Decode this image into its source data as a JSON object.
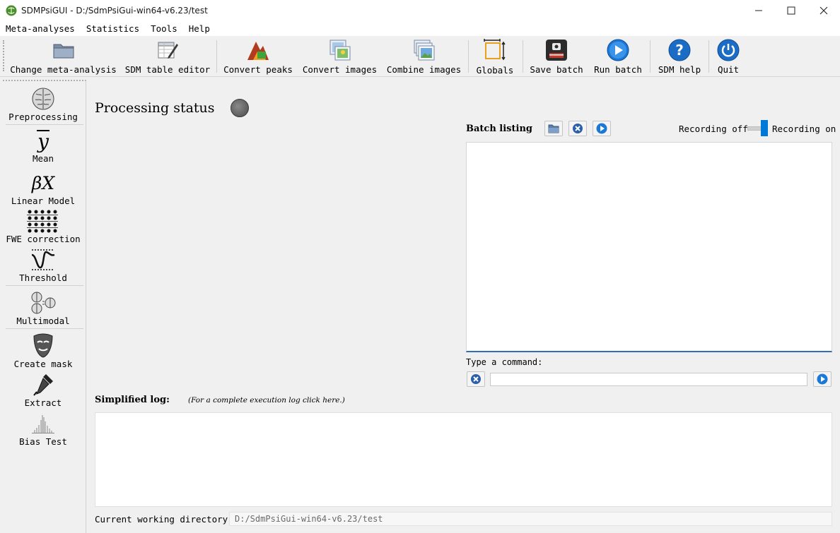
{
  "window": {
    "title": "SDMPsiGUI - D:/SdmPsiGui-win64-v6.23/test",
    "controls": [
      "minimize-icon",
      "maximize-icon",
      "close-icon"
    ]
  },
  "menu": {
    "items": [
      "Meta-analyses",
      "Statistics",
      "Tools",
      "Help"
    ]
  },
  "toolbar": {
    "buttons": [
      {
        "label": "Change meta-analysis",
        "icon": "folder-icon"
      },
      {
        "label": "SDM table editor",
        "icon": "table-edit-icon"
      },
      {
        "label": "Convert peaks",
        "icon": "peaks-icon"
      },
      {
        "label": "Convert images",
        "icon": "image-convert-icon"
      },
      {
        "label": "Combine images",
        "icon": "image-stack-icon"
      },
      {
        "label": "Globals",
        "icon": "globals-icon"
      },
      {
        "label": "Save batch",
        "icon": "save-batch-icon"
      },
      {
        "label": "Run batch",
        "icon": "play-icon"
      },
      {
        "label": "SDM help",
        "icon": "help-icon"
      },
      {
        "label": "Quit",
        "icon": "power-icon"
      }
    ]
  },
  "sidebar": {
    "items": [
      {
        "label": "Preprocessing",
        "icon": "brain-icon"
      },
      {
        "label": "Mean",
        "icon": "mean-icon",
        "symbol": "y"
      },
      {
        "label": "Linear Model",
        "icon": "linear-model-icon",
        "symbol": "βX"
      },
      {
        "label": "FWE correction",
        "icon": "grid-icon"
      },
      {
        "label": "Threshold",
        "icon": "threshold-icon"
      },
      {
        "label": "Multimodal",
        "icon": "multimodal-icon"
      },
      {
        "label": "Create mask",
        "icon": "mask-icon"
      },
      {
        "label": "Extract",
        "icon": "dropper-icon"
      },
      {
        "label": "Bias Test",
        "icon": "funnel-plot-icon"
      }
    ]
  },
  "main": {
    "processing_status": "Processing status",
    "batch": {
      "label": "Batch listing",
      "recording_off": "Recording off",
      "recording_on": "Recording on",
      "recording_state": "on"
    },
    "command": {
      "label": "Type a command:",
      "value": ""
    },
    "log": {
      "label": "Simplified log:",
      "hint": "(For a complete execution log click here.)"
    },
    "cwd": {
      "label": "Current working directory:",
      "value": "D:/SdmPsiGui-win64-v6.23/test"
    }
  },
  "colors": {
    "accent": "#0078d7",
    "status_led": "#5a5a5a",
    "play_blue": "#1a78d6"
  }
}
